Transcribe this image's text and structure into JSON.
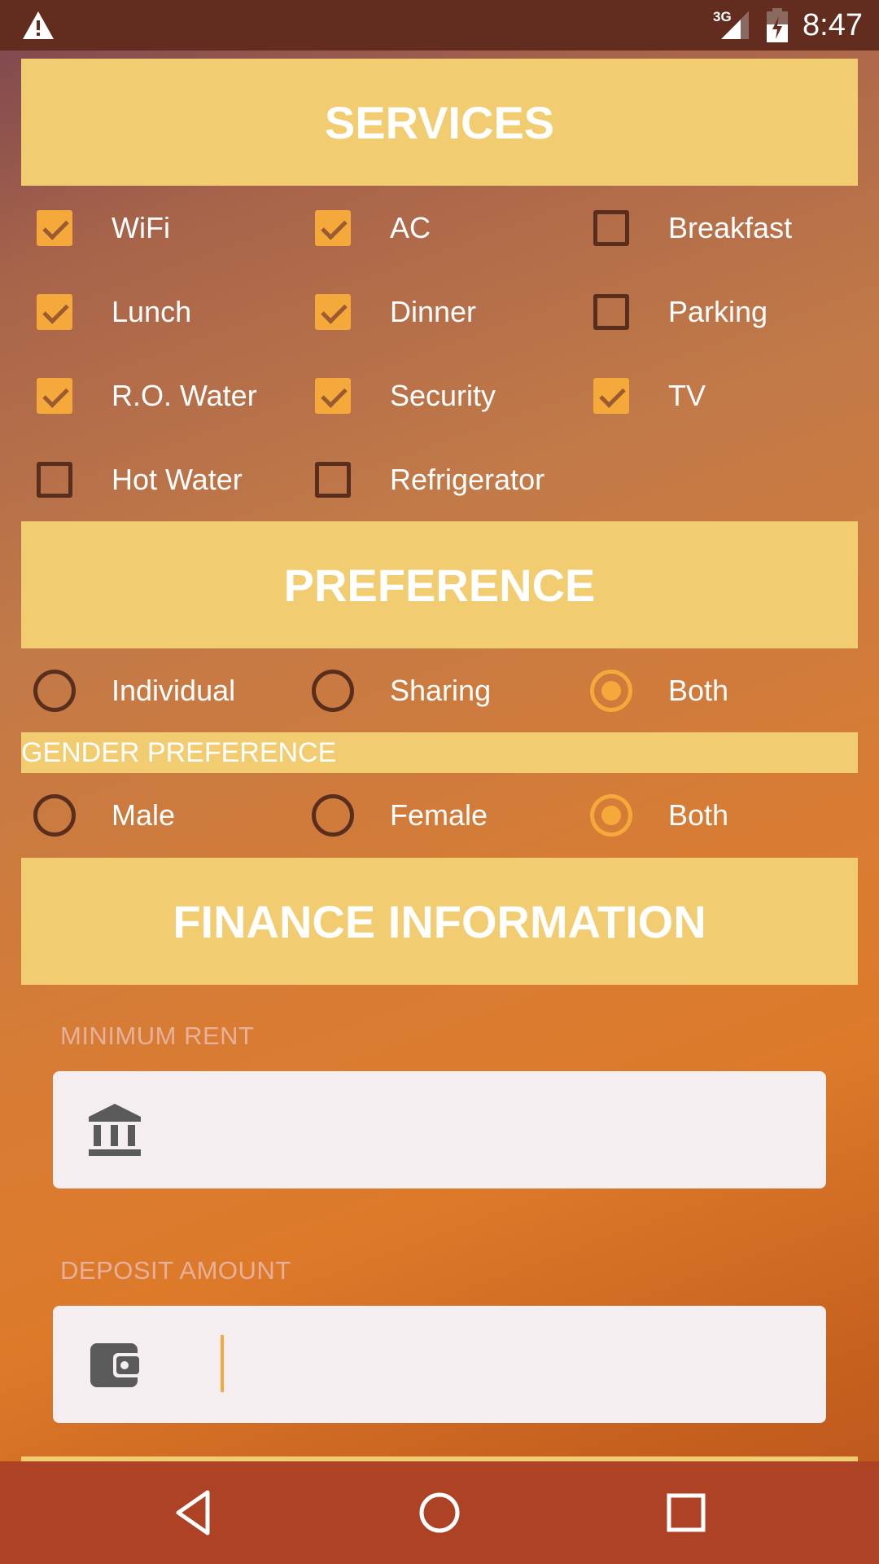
{
  "status_bar": {
    "network": "3G",
    "time": "8:47",
    "icons": [
      "warning-icon",
      "signal-icon",
      "battery-charging-icon"
    ]
  },
  "services": {
    "title": "SERVICES",
    "items": [
      {
        "label": "WiFi",
        "checked": true
      },
      {
        "label": "AC",
        "checked": true
      },
      {
        "label": "Breakfast",
        "checked": false
      },
      {
        "label": "Lunch",
        "checked": true
      },
      {
        "label": "Dinner",
        "checked": true
      },
      {
        "label": "Parking",
        "checked": false
      },
      {
        "label": "R.O. Water",
        "checked": true
      },
      {
        "label": "Security",
        "checked": true
      },
      {
        "label": "TV",
        "checked": true
      },
      {
        "label": "Hot Water",
        "checked": false
      },
      {
        "label": "Refrigerator",
        "checked": false
      }
    ]
  },
  "preference": {
    "title": "PREFERENCE",
    "options": [
      {
        "label": "Individual",
        "selected": false
      },
      {
        "label": "Sharing",
        "selected": false
      },
      {
        "label": "Both",
        "selected": true
      }
    ]
  },
  "gender_preference": {
    "title": "GENDER PREFERENCE",
    "options": [
      {
        "label": "Male",
        "selected": false
      },
      {
        "label": "Female",
        "selected": false
      },
      {
        "label": "Both",
        "selected": true
      }
    ]
  },
  "finance": {
    "title": "FINANCE INFORMATION",
    "minimum_rent": {
      "label": "MINIMUM RENT",
      "value": "",
      "icon": "bank-icon"
    },
    "deposit_amount": {
      "label": "DEPOSIT AMOUNT",
      "value": "",
      "icon": "wallet-icon"
    }
  },
  "colors": {
    "header_bg": "#f2cc70",
    "accent": "#f6a93b",
    "status_bar": "#622c1e",
    "nav_bar": "#ad4324"
  },
  "nav_bar": {
    "icons": [
      "back-icon",
      "home-icon",
      "recents-icon"
    ]
  }
}
